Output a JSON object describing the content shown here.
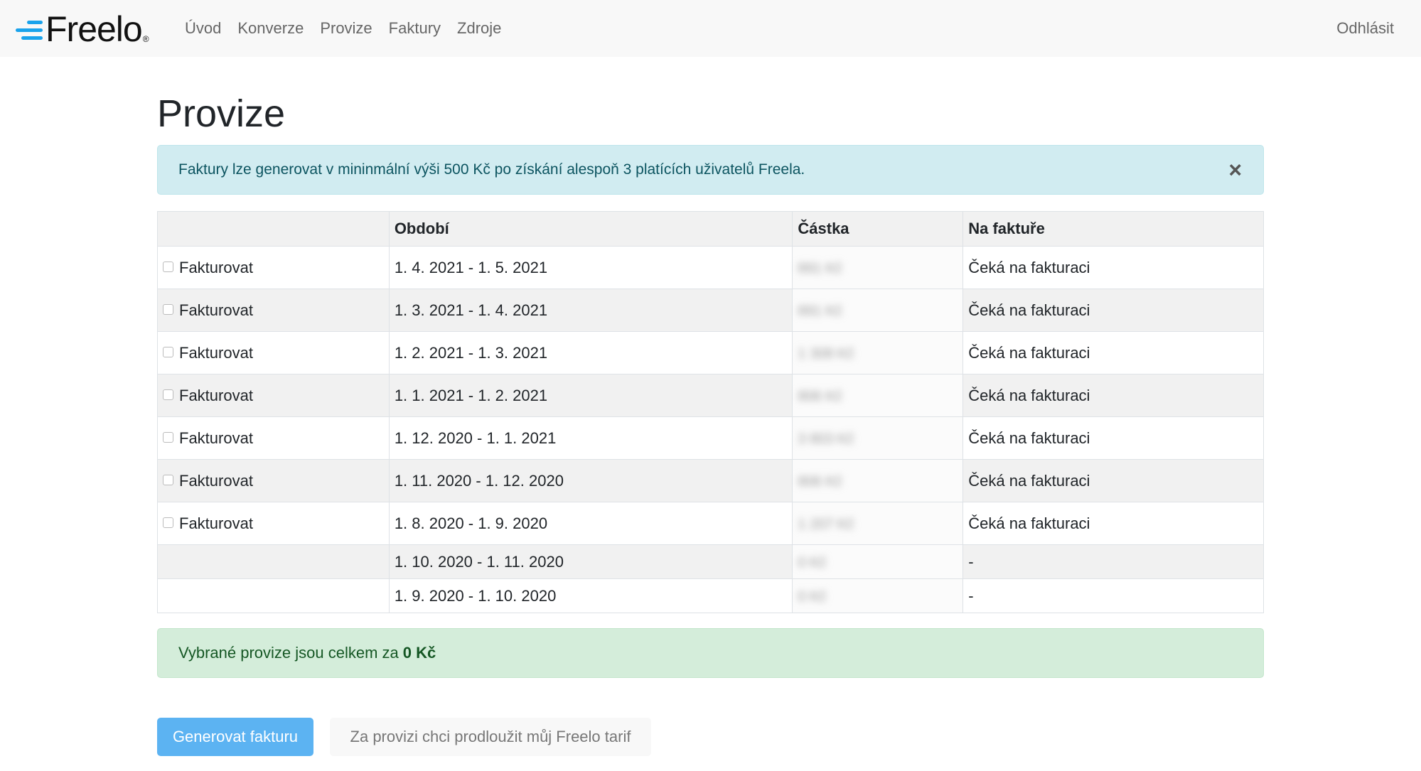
{
  "brand": {
    "name": "Freelo",
    "reg": "®",
    "accent_color": "#1aa3ec"
  },
  "nav": {
    "items": [
      {
        "label": "Úvod"
      },
      {
        "label": "Konverze"
      },
      {
        "label": "Provize"
      },
      {
        "label": "Faktury"
      },
      {
        "label": "Zdroje"
      }
    ],
    "logout": "Odhlásit"
  },
  "page": {
    "title": "Provize"
  },
  "info_alert": {
    "text": "Faktury lze generovat v mininmální výši 500 Kč po získání alespoň 3 platících uživatelů Freela.",
    "close": "×"
  },
  "table": {
    "headers": [
      "",
      "Období",
      "Částka",
      "Na faktuře"
    ],
    "rows": [
      {
        "checkbox_label": "Fakturovat",
        "period": "1. 4. 2021 - 1. 5. 2021",
        "amount": "891 Kč",
        "status": "Čeká na fakturaci"
      },
      {
        "checkbox_label": "Fakturovat",
        "period": "1. 3. 2021 - 1. 4. 2021",
        "amount": "891 Kč",
        "status": "Čeká na fakturaci"
      },
      {
        "checkbox_label": "Fakturovat",
        "period": "1. 2. 2021 - 1. 3. 2021",
        "amount": "1 308 Kč",
        "status": "Čeká na fakturaci"
      },
      {
        "checkbox_label": "Fakturovat",
        "period": "1. 1. 2021 - 1. 2. 2021",
        "amount": "806 Kč",
        "status": "Čeká na fakturaci"
      },
      {
        "checkbox_label": "Fakturovat",
        "period": "1. 12. 2020 - 1. 1. 2021",
        "amount": "3 803 Kč",
        "status": "Čeká na fakturaci"
      },
      {
        "checkbox_label": "Fakturovat",
        "period": "1. 11. 2020 - 1. 12. 2020",
        "amount": "806 Kč",
        "status": "Čeká na fakturaci"
      },
      {
        "checkbox_label": "Fakturovat",
        "period": "1. 8. 2020 - 1. 9. 2020",
        "amount": "1 207 Kč",
        "status": "Čeká na fakturaci"
      },
      {
        "checkbox_label": "",
        "period": "1. 10. 2020 - 1. 11. 2020",
        "amount": "0 Kč",
        "status": "-"
      },
      {
        "checkbox_label": "",
        "period": "1. 9. 2020 - 1. 10. 2020",
        "amount": "0 Kč",
        "status": "-"
      }
    ]
  },
  "summary": {
    "text": "Vybrané provize jsou celkem za",
    "total": "0 Kč"
  },
  "buttons": {
    "generate": "Generovat fakturu",
    "extend": "Za provizi chci prodloužit můj Freelo tarif"
  }
}
